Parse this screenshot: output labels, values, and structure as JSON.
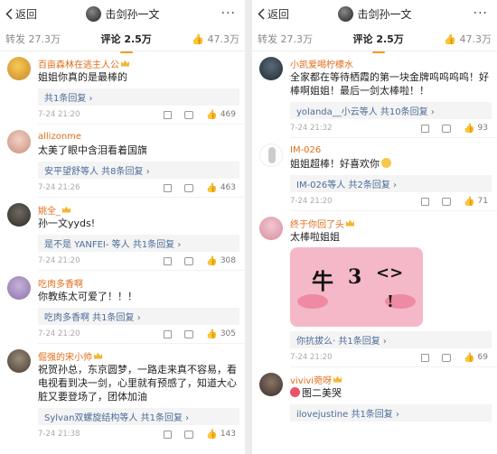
{
  "nav": {
    "back_label": "返回",
    "title": "击剑孙一文",
    "more": "···"
  },
  "tabs": {
    "repost": "转发 27.3万",
    "comments": "评论 2.5万",
    "likes": "47.3万"
  },
  "left": {
    "comments": [
      {
        "user": "百亩森林在逃主人公",
        "text": "姐姐你真的是最棒的",
        "reply": "共1条回复 ›",
        "time": "7-24 21:20",
        "likes": "469"
      },
      {
        "user": "allizonme",
        "text": "太美了眼中含泪看着国旗",
        "reply": "安平望舒等人  共8条回复 ›",
        "time": "7-24 21:26",
        "likes": "463"
      },
      {
        "user": "姚全_",
        "text": "孙一文yyds!",
        "reply": "是不是 YANFEI- 等人  共1条回复 ›",
        "time": "7-24 21:20",
        "likes": "308"
      },
      {
        "user": "吃肉多香啊",
        "text": "你教练太可爱了！！！",
        "reply": "吃肉多香啊  共1条回复 ›",
        "time": "7-24 21:20",
        "likes": "305"
      },
      {
        "user": "倔强的宋小帅",
        "text": "祝贺孙总，东京圆梦，一路走来真不容易，看电视看到决一剑，心里就有预感了，知道大心脏又要登场了，团体加油",
        "reply": "Sylvan双螺旋结构等人  共1条回复 ›",
        "time": "7-24 21:38",
        "likes": "143"
      }
    ]
  },
  "right": {
    "comments": [
      {
        "user": "小凯爱喝柠檬水",
        "text": "全家都在等待栖霞的第一块金牌呜呜呜呜！好棒啊姐姐！最后一剑太棒啦！！",
        "reply": "yolanda__小云等人  共10条回复 ›",
        "time": "7-24 21:32",
        "likes": "93"
      },
      {
        "user": "IM-026",
        "text": "姐姐超棒！好喜欢你",
        "reply": "IM-026等人  共2条回复 ›",
        "time": "7-24 21:20",
        "likes": "71"
      },
      {
        "user": "终于你回了头",
        "text": "太棒啦姐姐",
        "reply": "你抗拔么·  共1条回复 ›",
        "time": "7-24 21:20",
        "likes": "69",
        "sticker_glyphs": [
          "牛",
          "3",
          "<>",
          "!"
        ]
      },
      {
        "user": "vivivi菀呀",
        "text": "图二美哭",
        "reply": "ilovejustine  共1条回复 ›",
        "time": "",
        "likes": ""
      }
    ]
  },
  "colors": {
    "username": "#e06e1b",
    "reply_link": "#4b6c99",
    "tab_indicator": "#f59b17"
  }
}
